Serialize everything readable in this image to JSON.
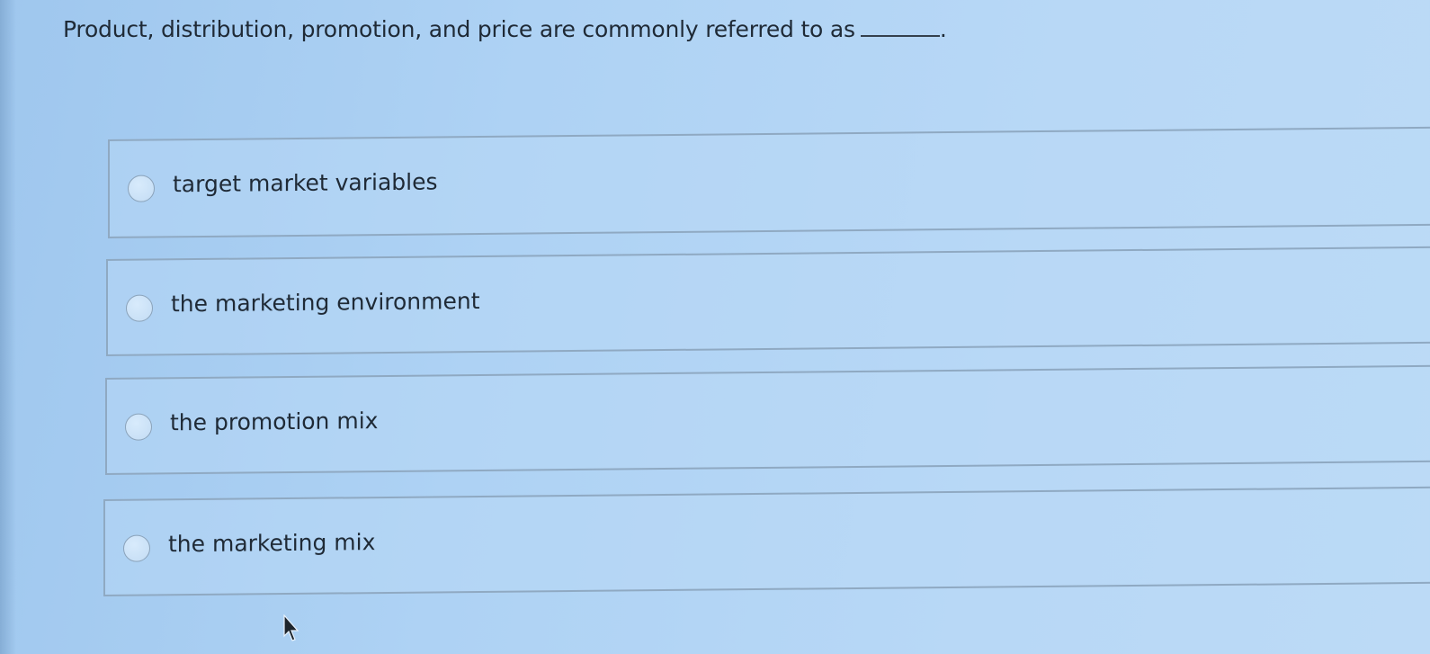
{
  "question": {
    "text": "Product, distribution, promotion, and price are commonly referred to as",
    "end": "."
  },
  "options": [
    {
      "label": "target market variables",
      "selected": false
    },
    {
      "label": "the marketing environment",
      "selected": false
    },
    {
      "label": "the promotion mix",
      "selected": false
    },
    {
      "label": "the marketing mix",
      "selected": false
    }
  ],
  "cursor_icon": "mouse-pointer-icon"
}
